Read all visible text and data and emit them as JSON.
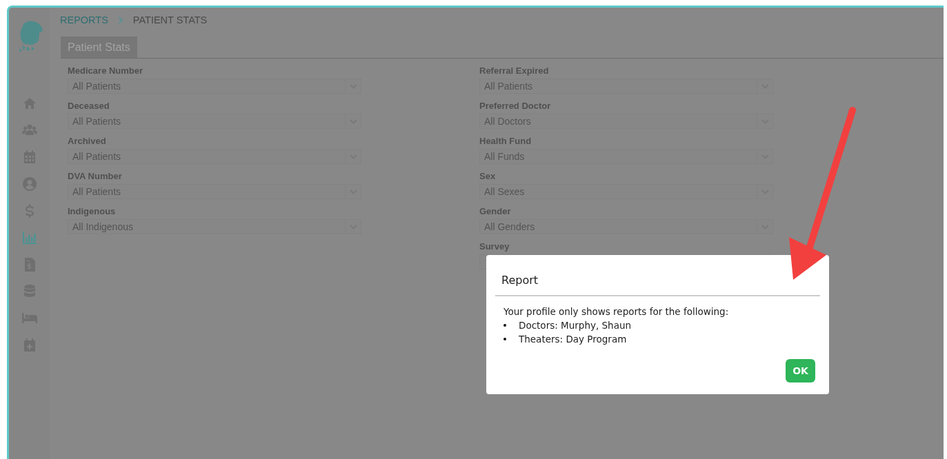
{
  "sidebar": {
    "items": [
      {
        "kind": "home",
        "selected": false
      },
      {
        "kind": "users",
        "selected": false
      },
      {
        "kind": "calendar",
        "selected": false
      },
      {
        "kind": "user",
        "selected": false
      },
      {
        "kind": "dollar",
        "selected": false
      },
      {
        "kind": "chart",
        "selected": true
      },
      {
        "kind": "invoice",
        "selected": false
      },
      {
        "kind": "database",
        "selected": false
      },
      {
        "kind": "bed",
        "selected": false
      },
      {
        "kind": "calendar-plus",
        "selected": false
      }
    ]
  },
  "breadcrumb": [
    {
      "label": "REPORTS",
      "kind": "link"
    },
    {
      "label": "PATIENT STATS",
      "kind": "current"
    }
  ],
  "tabs": [
    {
      "label": "Patient Stats",
      "selected": true
    }
  ],
  "filters": {
    "left": [
      {
        "label": "Medicare Number",
        "value": "All Patients"
      },
      {
        "label": "Deceased",
        "value": "All Patients"
      },
      {
        "label": "Archived",
        "value": "All Patients"
      },
      {
        "label": "DVA Number",
        "value": "All Patients"
      },
      {
        "label": "Indigenous",
        "value": "All Indigenous"
      }
    ],
    "right": [
      {
        "label": "Referral Expired",
        "value": "All Patients"
      },
      {
        "label": "Preferred Doctor",
        "value": "All Doctors"
      },
      {
        "label": "Health Fund",
        "value": "All Funds"
      },
      {
        "label": "Sex",
        "value": "All Sexes"
      },
      {
        "label": "Gender",
        "value": "All Genders"
      },
      {
        "label": "Survey"
      }
    ]
  },
  "dialog": {
    "title": "Report",
    "message": "Your profile only shows reports for the following:",
    "items": [
      "Doctors: Murphy, Shaun",
      "Theaters: Day Program"
    ],
    "buttons": [
      "OK"
    ]
  }
}
